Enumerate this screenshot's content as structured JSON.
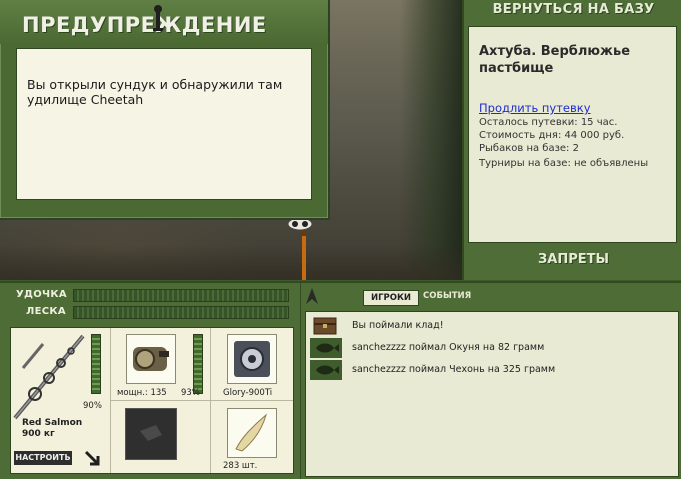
{
  "dialog": {
    "title": "ПРЕДУПРЕЖДЕНИЕ",
    "message": "Вы открыли сундук и обнаружили там удилище Cheetah"
  },
  "info": {
    "back_label": "ВЕРНУТЬСЯ НА БАЗУ",
    "place": "Ахтуба. Верблюжье пастбище",
    "extend_label": "Продлить путевку",
    "remaining": "Осталось путевки: 15 час.",
    "day_cost": "Стоимость дня: 44 000 руб.",
    "anglers": "Рыбаков на базе: 2",
    "tournaments": "Турниры на базе: не объявлены",
    "bans_label": "ЗАПРЕТЫ"
  },
  "gear": {
    "rod_label": "УДОЧКА",
    "line_label": "ЛЕСКА",
    "rod_name": "Red Salmon",
    "rod_test": "900 кг",
    "rod_percent": "90%",
    "rod_condition": 0.9,
    "reel_power": "мощн.: 135",
    "reel_percent": "93%",
    "reel_condition": 0.93,
    "line_name": "Glory-900Ti",
    "bait_count": "283 шт.",
    "tune_label": "НАСТРОИТЬ",
    "icons": [
      "rod-icon",
      "reel-icon",
      "line-spool-icon",
      "empty-slot-icon",
      "bait-icon",
      "settings-arrow-icon"
    ]
  },
  "log": {
    "tab_players": "ИГРОКИ",
    "tab_events": "СОБЫТИЯ",
    "entries": [
      {
        "icon": "chest-icon",
        "text": "Вы поймали клад!"
      },
      {
        "icon": "fish-icon",
        "text": "sanchezzzz поймал Окуня на 82 грамм"
      },
      {
        "icon": "fish-icon",
        "text": "sanchezzzz поймал Чехонь на 325 грамм"
      }
    ]
  },
  "colors": {
    "panel": "#4d6c36",
    "paper": "#e9ead3",
    "link": "#1c2dcc"
  }
}
